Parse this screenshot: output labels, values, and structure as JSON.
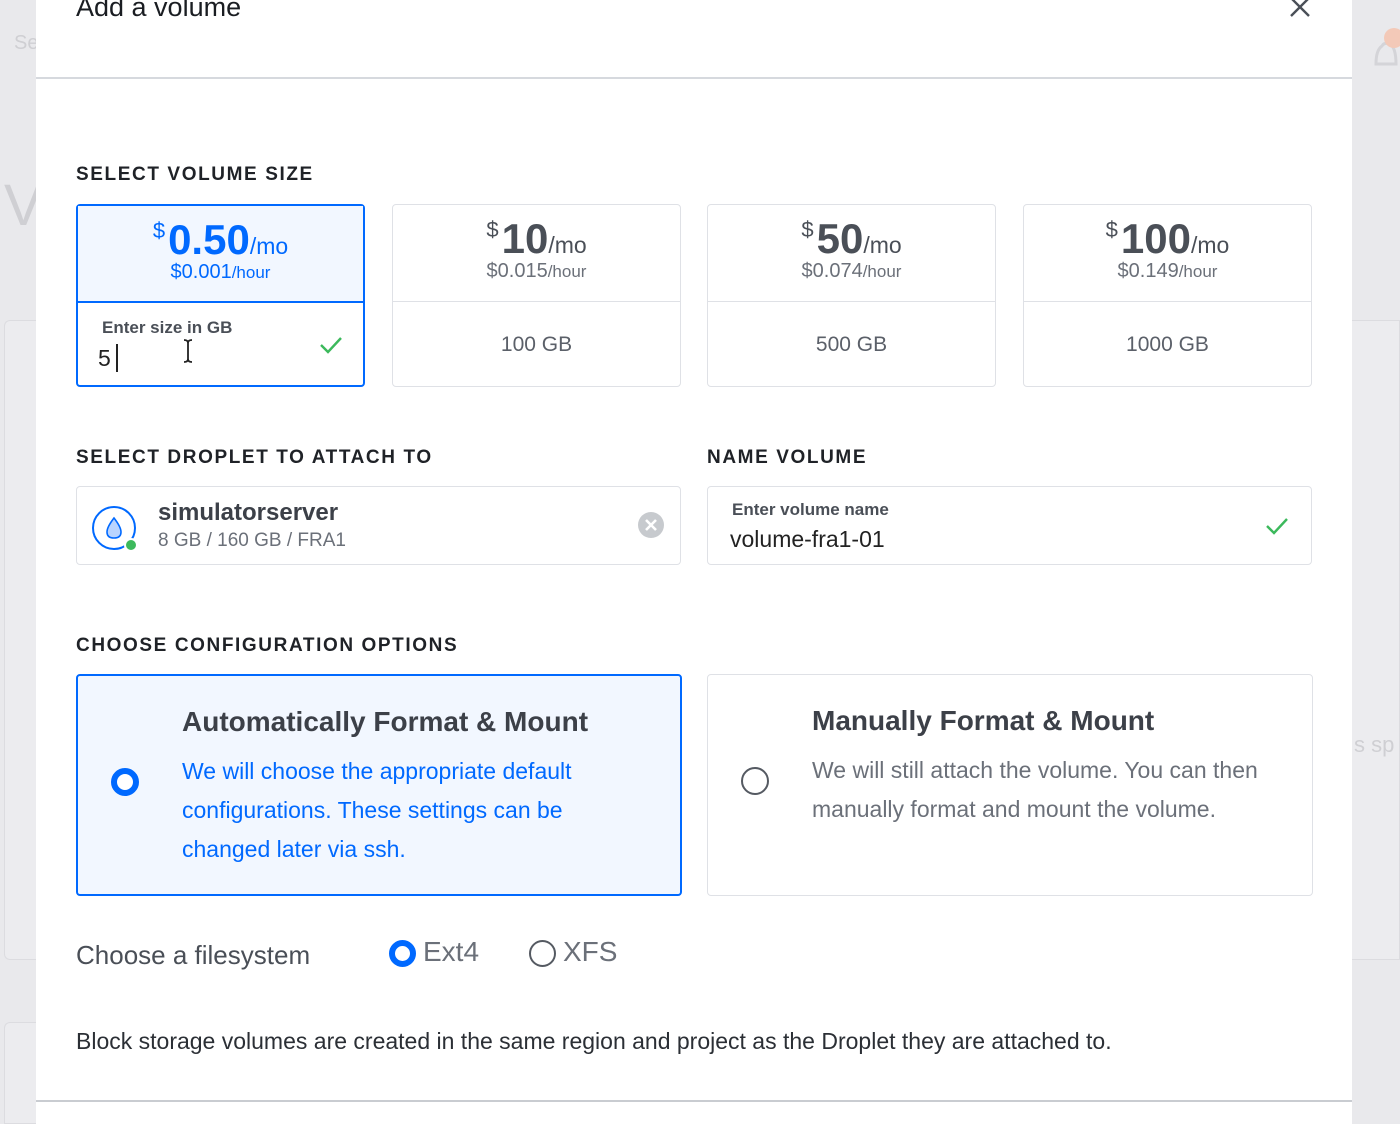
{
  "background": {
    "search_fragment": "Se",
    "heading_fragment": "V",
    "right_fragment": "s sp"
  },
  "modal": {
    "title": "Add a volume",
    "close_icon": "close-icon"
  },
  "size_section": {
    "label": "SELECT VOLUME SIZE",
    "options": [
      {
        "currency": "$",
        "amount": "0.50",
        "per": "/mo",
        "hourly": "$0.001",
        "hour_unit": "/hour",
        "custom_label": "Enter size in GB",
        "custom_value": "5",
        "selected": true
      },
      {
        "currency": "$",
        "amount": "10",
        "per": "/mo",
        "hourly": "$0.015",
        "hour_unit": "/hour",
        "size": "100 GB"
      },
      {
        "currency": "$",
        "amount": "50",
        "per": "/mo",
        "hourly": "$0.074",
        "hour_unit": "/hour",
        "size": "500 GB"
      },
      {
        "currency": "$",
        "amount": "100",
        "per": "/mo",
        "hourly": "$0.149",
        "hour_unit": "/hour",
        "size": "1000 GB"
      }
    ]
  },
  "droplet_section": {
    "label": "SELECT DROPLET TO ATTACH TO",
    "droplet_name": "simulatorserver",
    "droplet_spec": "8 GB / 160 GB / FRA1",
    "status_color": "#3cb95c"
  },
  "name_section": {
    "label": "NAME VOLUME",
    "field_label": "Enter volume name",
    "value": "volume-fra1-01"
  },
  "config_section": {
    "label": "CHOOSE CONFIGURATION OPTIONS",
    "options": [
      {
        "title": "Automatically Format & Mount",
        "description": "We will choose the appropriate default configurations. These settings can be changed later via ssh.",
        "selected": true
      },
      {
        "title": "Manually Format & Mount",
        "description": "We will still attach the volume. You can then manually format and mount the volume.",
        "selected": false
      }
    ]
  },
  "filesystem": {
    "label": "Choose a filesystem",
    "options": [
      {
        "label": "Ext4",
        "selected": true
      },
      {
        "label": "XFS",
        "selected": false
      }
    ]
  },
  "info_text": "Block storage volumes are created in the same region and project as the Droplet they are attached to.",
  "colors": {
    "accent": "#0069ff",
    "success": "#3cb95c",
    "border": "#dfe1e6"
  }
}
